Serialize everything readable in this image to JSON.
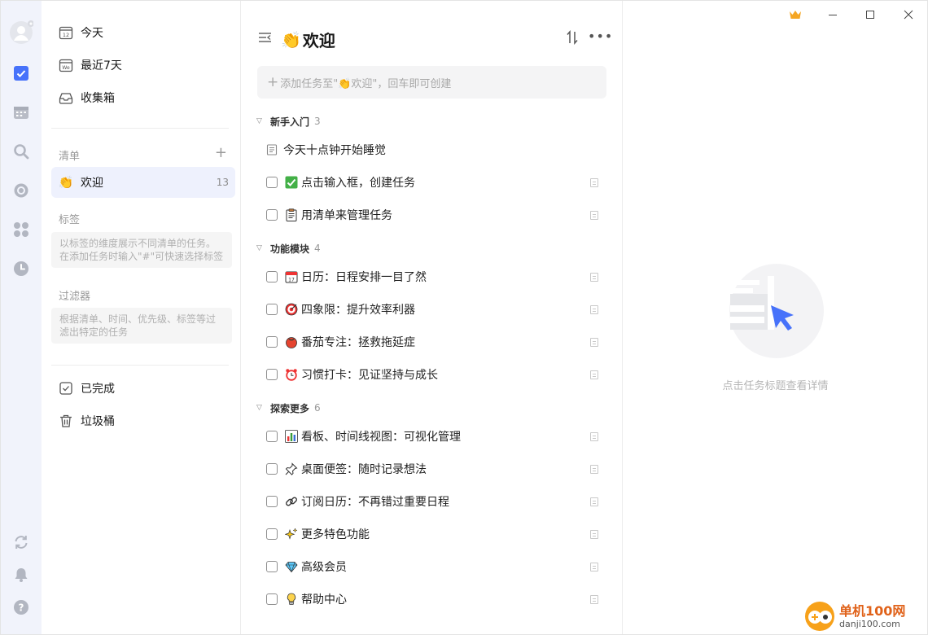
{
  "nav": {
    "today": "今天",
    "today_icon_text": "12",
    "next7": "最近7天",
    "next7_icon_text": "We",
    "inbox": "收集箱",
    "lists_title": "清单",
    "welcome_list": {
      "label": "欢迎",
      "count": "13"
    },
    "tags_title": "标签",
    "tags_hint": "以标签的维度展示不同清单的任务。在添加任务时输入\"#\"可快速选择标签",
    "filters_title": "过滤器",
    "filters_hint": "根据清单、时间、优先级、标签等过滤出特定的任务",
    "completed": "已完成",
    "trash": "垃圾桶"
  },
  "rail_icons": [
    "avatar",
    "checkbox-icon",
    "calendar-icon",
    "search-icon",
    "pomodoro-icon",
    "grid-icon",
    "clock-icon",
    "sync-icon",
    "bell-icon",
    "help-icon"
  ],
  "task_list": {
    "title": "欢迎",
    "add_placeholder": "添加任务至\"👏欢迎\"，回车即可创建",
    "groups": [
      {
        "name": "新手入门",
        "count": "3",
        "tasks": [
          {
            "text": "今天十点钟开始睡觉",
            "type": "note"
          },
          {
            "text": "点击输入框，创建任务",
            "emoji": "✅"
          },
          {
            "text": "用清单来管理任务",
            "emoji": "📋"
          }
        ]
      },
      {
        "name": "功能模块",
        "count": "4",
        "tasks": [
          {
            "text": "日历：日程安排一目了然",
            "emoji": "📅"
          },
          {
            "text": "四象限：提升效率利器",
            "emoji": "🎯"
          },
          {
            "text": "番茄专注：拯救拖延症",
            "emoji": "🍅"
          },
          {
            "text": "习惯打卡：见证坚持与成长",
            "emoji": "⏰"
          }
        ]
      },
      {
        "name": "探索更多",
        "count": "6",
        "tasks": [
          {
            "text": "看板、时间线视图：可视化管理",
            "emoji": "📊"
          },
          {
            "text": "桌面便签：随时记录想法",
            "emoji": "📌"
          },
          {
            "text": "订阅日历：不再错过重要日程",
            "emoji": "🔗"
          },
          {
            "text": "更多特色功能",
            "emoji": "✨"
          },
          {
            "text": "高级会员",
            "emoji": "💎"
          },
          {
            "text": "帮助中心",
            "emoji": "💡"
          }
        ]
      }
    ]
  },
  "detail": {
    "empty_text": "点击任务标题查看详情"
  },
  "watermark": {
    "brand": "单机100网",
    "domain": "danji100.com"
  },
  "colors": {
    "accent": "#4772fa",
    "rail_bg": "#f1f3fb",
    "crown": "#f5a623"
  }
}
